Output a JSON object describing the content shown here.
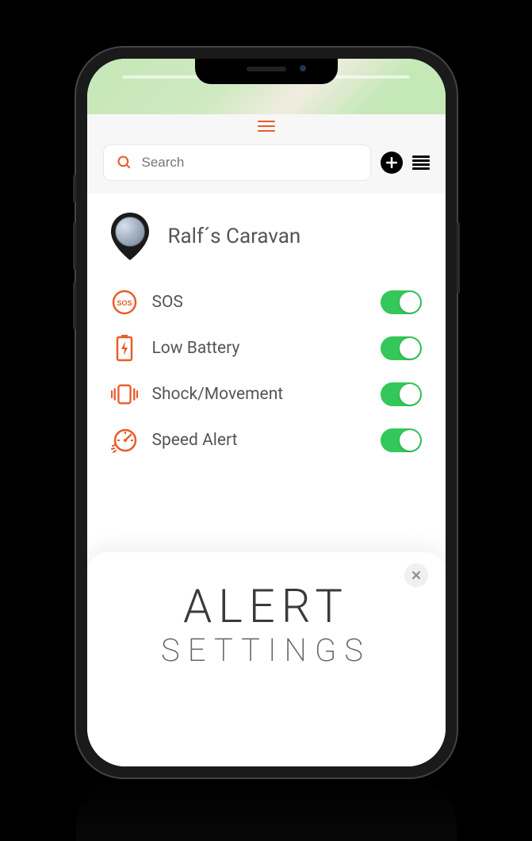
{
  "search": {
    "placeholder": "Search"
  },
  "device": {
    "name": "Ralf´s Caravan"
  },
  "alerts": [
    {
      "id": "sos",
      "label": "SOS",
      "on": true
    },
    {
      "id": "low-battery",
      "label": "Low Battery",
      "on": true
    },
    {
      "id": "shock-movement",
      "label": "Shock/Movement",
      "on": true
    },
    {
      "id": "speed-alert",
      "label": "Speed Alert",
      "on": true
    }
  ],
  "overlay": {
    "title": "ALERT",
    "subtitle": "SETTINGS"
  },
  "colors": {
    "accent": "#e85d2a",
    "toggle_on": "#34c759"
  }
}
